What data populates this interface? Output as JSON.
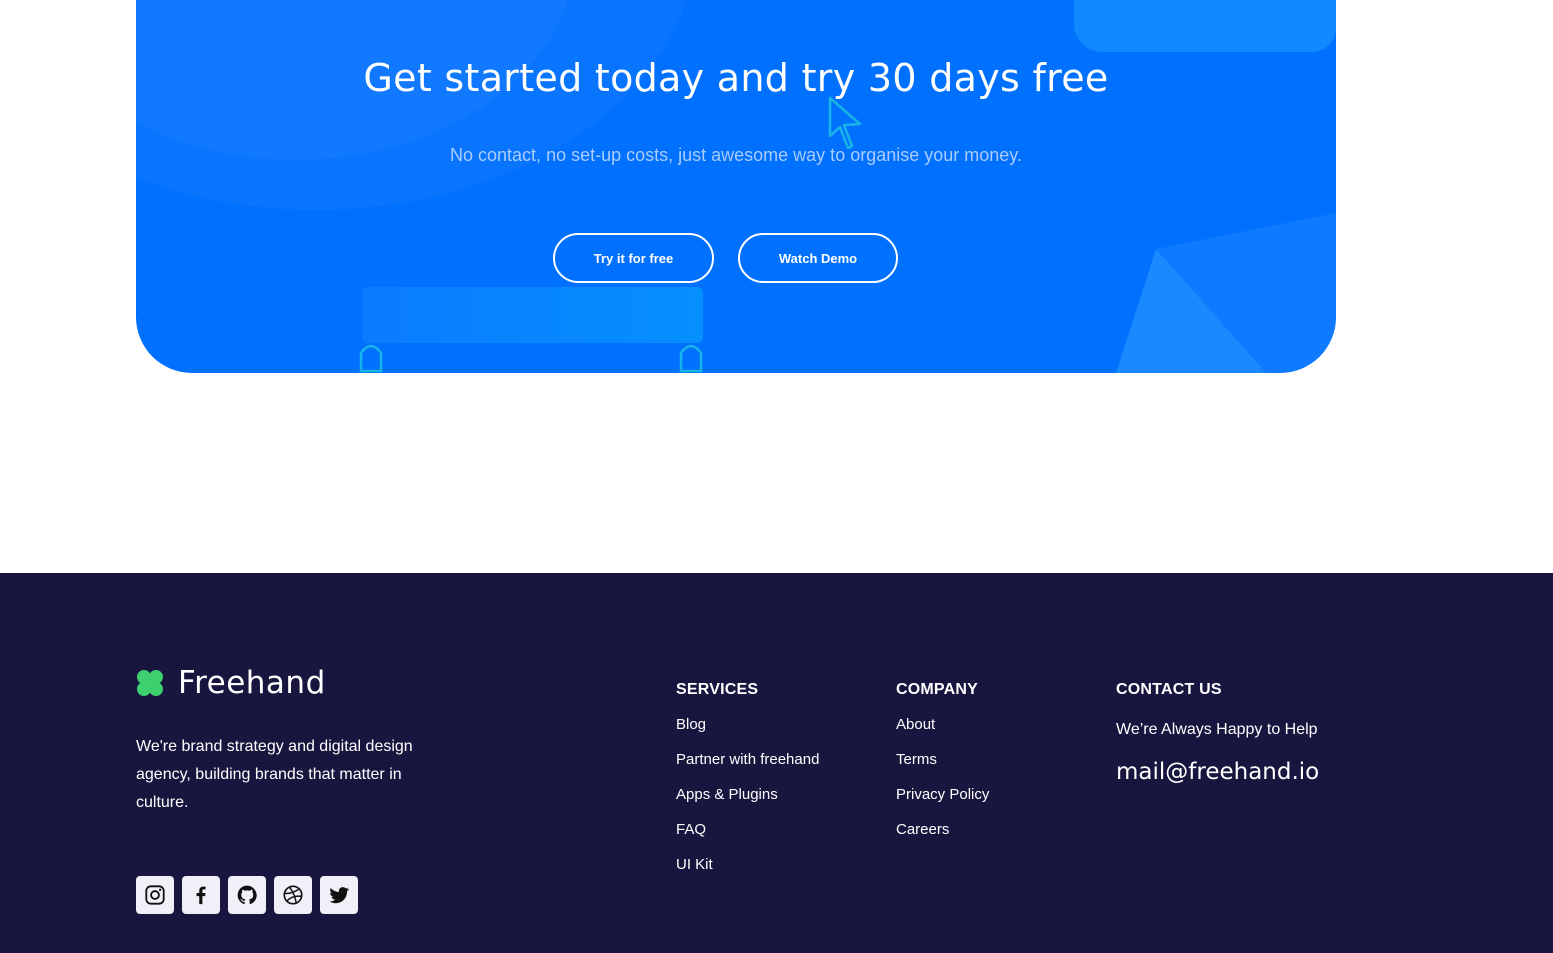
{
  "cta": {
    "title": "Get started today and try 30 days free",
    "subtitle": "No contact, no set-up costs, just awesome way to organise your money.",
    "try_label": "Try it for free",
    "demo_label": "Watch Demo"
  },
  "footer": {
    "brand": "Freehand",
    "tagline": "We're brand strategy and digital design agency, building brands that matter in culture.",
    "socials": [
      {
        "name": "instagram-icon"
      },
      {
        "name": "facebook-icon"
      },
      {
        "name": "github-icon"
      },
      {
        "name": "dribbble-icon"
      },
      {
        "name": "twitter-icon"
      }
    ],
    "services": {
      "heading": "SERVICES",
      "items": [
        "Blog",
        "Partner with freehand",
        "Apps & Plugins",
        "FAQ",
        "UI Kit"
      ]
    },
    "company": {
      "heading": "COMPANY",
      "items": [
        "About",
        "Terms",
        "Privacy Policy",
        "Careers"
      ]
    },
    "contact": {
      "heading": "CONTACT US",
      "line": "We’re Always Happy to Help",
      "email": "mail@freehand.io"
    }
  },
  "colors": {
    "cta_background": "#0070ff",
    "footer_background": "#18153e",
    "logo_green": "#3ecf6e",
    "subtitle": "#a9ccff"
  }
}
